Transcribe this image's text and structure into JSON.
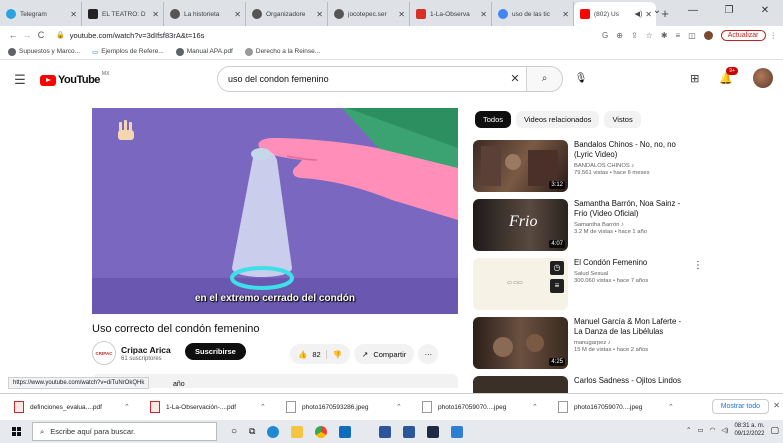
{
  "browser": {
    "tabs": [
      {
        "title": "Telegram",
        "color": "#2aa3df"
      },
      {
        "title": "EL TEATRO: D",
        "color": "#222222"
      },
      {
        "title": "La historieta",
        "color": "#555555"
      },
      {
        "title": "Organizadore",
        "color": "#555555"
      },
      {
        "title": "jocotepec.ser",
        "color": "#555555"
      },
      {
        "title": "1-La-Observa",
        "color": "#d93025"
      },
      {
        "title": "uso de las tic",
        "color": "#4285f4"
      },
      {
        "title": "(802) Us",
        "color": "#ff0000"
      }
    ],
    "new_tab": "+",
    "url": "youtube.com/watch?v=3dIfsf83rA&t=16s",
    "update_label": "Actualizar",
    "bookmarks": [
      "Supuestos y Marco...",
      "Ejemplos de Refere...",
      "Manual APA.pdf",
      "Derecho a la Reinse..."
    ]
  },
  "youtube": {
    "logo_text": "YouTube",
    "country_code": "MX",
    "search_value": "uso del condon femenino",
    "notification_count": "9+"
  },
  "video": {
    "caption": "en el extremo cerrado del condón",
    "title": "Uso correcto del condón femenino",
    "channel_logo_text": "CRIPAC",
    "channel_name": "Cripac Arica",
    "subscribers": "61 suscriptores",
    "subscribe_label": "Suscribirse",
    "likes": "82",
    "share_label": "Compartir",
    "year_peek": "año",
    "status_url": "https://www.youtube.com/watch?v=diTuNrOkQHk"
  },
  "filters": [
    "Todos",
    "Videos relacionados",
    "Vistos"
  ],
  "related": [
    {
      "title_1": "Bandalos Chinos - No, no, no",
      "title_2": "(Lyric Video)",
      "channel": "BANDALOS CHINOS ♪",
      "meta": "79.561 vistas • hace 6 meses",
      "duration": "3:12"
    },
    {
      "title_1": "Samantha Barrón, Noa Sainz -",
      "title_2": "Frio (Video Oficial)",
      "channel": "Samantha Barrón ♪",
      "meta": "3.2 M de vistas • hace 1 año",
      "duration": "4:07",
      "thumb_text": "Frio"
    },
    {
      "title_1": "El Condón Femenino",
      "title_2": "",
      "channel": "Salud Sexual",
      "meta": "300.060 vistas • hace 7 años",
      "duration": ""
    },
    {
      "title_1": "Manuel García & Mon Laferte -",
      "title_2": "La Danza de las Libélulas",
      "channel": "manugarpez ♪",
      "meta": "15 M de vistas • hace 2 años",
      "duration": "4:25"
    },
    {
      "title_1": "Carlos Sadness - Ojitos Lindos",
      "title_2": "",
      "channel": "",
      "meta": "",
      "duration": ""
    }
  ],
  "downloads": {
    "items": [
      "definciones_evalua....pdf",
      "1-La-Observación-....pdf",
      "photo1670593286.jpeg",
      "photo167059070....jpeg",
      "photo167059070....jpeg"
    ],
    "show_all": "Mostrar todo"
  },
  "taskbar": {
    "search_placeholder": "Escribe aquí para buscar.",
    "time": "08:31 a. m.",
    "date": "09/12/2022"
  }
}
